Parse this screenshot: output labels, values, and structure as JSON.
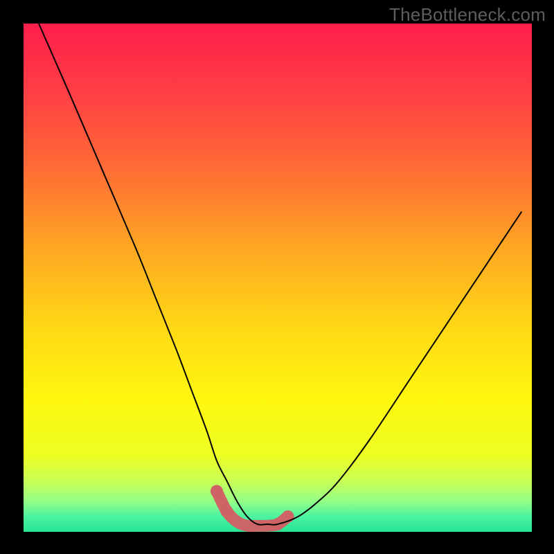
{
  "watermark": "TheBottleneck.com",
  "chart_data": {
    "type": "line",
    "title": "",
    "xlabel": "",
    "ylabel": "",
    "xlim": [
      0,
      100
    ],
    "ylim": [
      0,
      100
    ],
    "series": [
      {
        "name": "bottleneck-curve",
        "x": [
          3,
          10,
          16,
          22,
          26,
          30,
          33,
          36,
          38,
          40,
          42,
          44,
          46,
          48,
          50,
          54,
          58,
          62,
          68,
          76,
          86,
          98
        ],
        "values": [
          100,
          84,
          70,
          56,
          46,
          36,
          28,
          20,
          14,
          10,
          6,
          3,
          1.5,
          1.5,
          1.5,
          3,
          6,
          10,
          18,
          30,
          45,
          63
        ]
      },
      {
        "name": "optimal-band",
        "x": [
          38,
          40,
          42,
          44,
          46,
          48,
          50,
          52
        ],
        "values": [
          8,
          4,
          2,
          1.2,
          1.2,
          1.2,
          1.5,
          3
        ]
      }
    ],
    "gradient_stops": [
      {
        "pos": 0.0,
        "color": "#ff1f4c"
      },
      {
        "pos": 0.12,
        "color": "#ff3a46"
      },
      {
        "pos": 0.28,
        "color": "#ff6a36"
      },
      {
        "pos": 0.44,
        "color": "#ffa623"
      },
      {
        "pos": 0.6,
        "color": "#ffd915"
      },
      {
        "pos": 0.74,
        "color": "#fff70e"
      },
      {
        "pos": 0.85,
        "color": "#ecff24"
      },
      {
        "pos": 0.9,
        "color": "#c8ff55"
      },
      {
        "pos": 0.94,
        "color": "#94ff87"
      },
      {
        "pos": 0.97,
        "color": "#4cf3a1"
      },
      {
        "pos": 1.0,
        "color": "#27e494"
      }
    ],
    "band_color": "#cf6264",
    "band_highlight": "#d47d7f"
  }
}
